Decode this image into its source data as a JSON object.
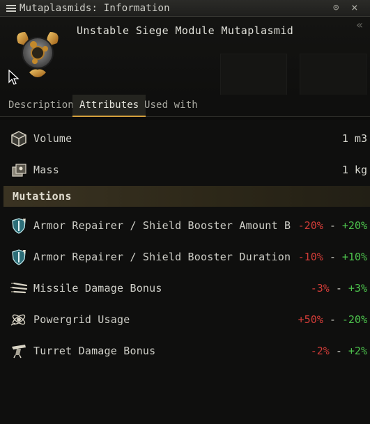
{
  "window": {
    "title": "Mutaplasmids: Information",
    "settings_glyph": "⊙",
    "close_glyph": "×",
    "collapse_glyph": "«"
  },
  "item": {
    "name": "Unstable Siege Module Mutaplasmid",
    "icon": "mutaplasmid-icon"
  },
  "tabs": [
    {
      "label": "Description",
      "active": false
    },
    {
      "label": "Attributes",
      "active": true
    },
    {
      "label": "Used with",
      "active": false
    }
  ],
  "attributes": [
    {
      "icon": "volume-cube-icon",
      "label": "Volume",
      "value": "1 m3"
    },
    {
      "icon": "mass-icon",
      "label": "Mass",
      "value": "1 kg"
    }
  ],
  "mutations": {
    "header": "Mutations",
    "separator": "-",
    "rows": [
      {
        "icon": "armor-shield-booster-icon",
        "label": "Armor Repairer / Shield Booster Amount Bonus",
        "min": "-20%",
        "max": "+20%",
        "min_color": "#d23c38",
        "max_color": "#4cc24c"
      },
      {
        "icon": "armor-shield-booster-icon",
        "label": "Armor Repairer / Shield Booster Duration Bonus",
        "min": "-10%",
        "max": "+10%",
        "min_color": "#d23c38",
        "max_color": "#4cc24c"
      },
      {
        "icon": "missile-icon",
        "label": "Missile Damage Bonus",
        "min": "-3%",
        "max": "+3%",
        "min_color": "#d23c38",
        "max_color": "#4cc24c"
      },
      {
        "icon": "powergrid-icon",
        "label": "Powergrid Usage",
        "min": "+50%",
        "max": "-20%",
        "min_color": "#d23c38",
        "max_color": "#4cc24c"
      },
      {
        "icon": "turret-icon",
        "label": "Turret Damage Bonus",
        "min": "-2%",
        "max": "+2%",
        "min_color": "#d23c38",
        "max_color": "#4cc24c"
      }
    ]
  },
  "colors": {
    "accent": "#d4a03c",
    "negative": "#d23c38",
    "positive": "#4cc24c"
  }
}
